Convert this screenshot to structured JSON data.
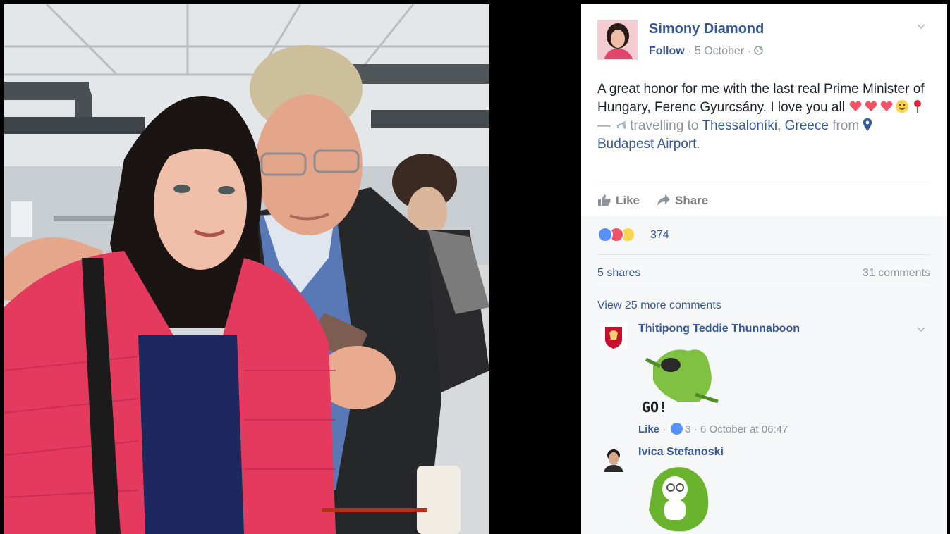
{
  "post": {
    "author": "Simony Diamond",
    "follow_label": "Follow",
    "date": "5 October",
    "dot": "·",
    "text_1": "A great honor for me with the last real Prime Minister of Hungary, Ferenc Gyurcsány. I love you all",
    "text_dash": " — ",
    "travelling": "travelling to",
    "destination": "Thessaloníki, Greece",
    "from_label": "from",
    "origin": "Budapest Airport",
    "period": ".",
    "icons": [
      "heart-emoji",
      "heart-emoji",
      "heart-emoji",
      "smile-emoji",
      "rose-emoji",
      "plane-icon",
      "pin-icon",
      "globe-icon"
    ]
  },
  "actions": {
    "like_label": "Like",
    "share_label": "Share"
  },
  "ufi": {
    "reaction_count": "374",
    "shares": "5 shares",
    "comments": "31 comments",
    "view_more": "View 25 more comments"
  },
  "comments": [
    {
      "name": "Thitipong Teddie Thunnaboon",
      "sticker_text": "GO!",
      "like_label": "Like",
      "dot": "·",
      "likes": "3",
      "timestamp": "6 October at 06:47"
    },
    {
      "name": "Ivica Stefanoski"
    }
  ],
  "colors": {
    "link": "#365899",
    "meta": "#90949c",
    "ufi_bg": "#f6f7f9",
    "like_blue": "#5890ff",
    "love_red": "#f25268",
    "wow_yellow": "#fcd34d"
  }
}
